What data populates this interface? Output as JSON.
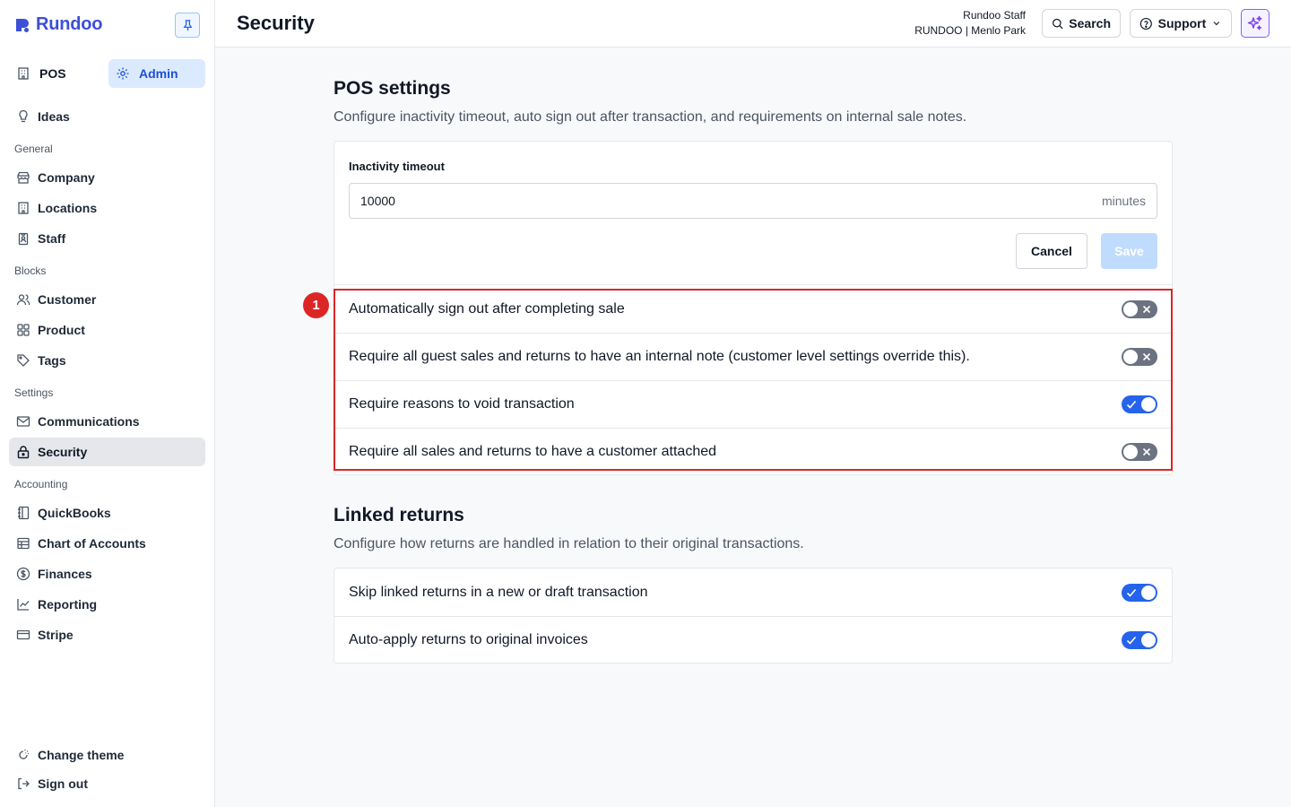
{
  "brand": {
    "name": "Rundoo"
  },
  "sidebar": {
    "modes": [
      {
        "label": "POS",
        "icon": "building-icon"
      },
      {
        "label": "Admin",
        "icon": "gear-icon",
        "active": true
      }
    ],
    "ideas": {
      "label": "Ideas",
      "icon": "lightbulb-icon"
    },
    "sections": {
      "general": "General",
      "blocks": "Blocks",
      "settings": "Settings",
      "accounting": "Accounting"
    },
    "items": {
      "company": "Company",
      "locations": "Locations",
      "staff": "Staff",
      "customer": "Customer",
      "product": "Product",
      "tags": "Tags",
      "communications": "Communications",
      "security": "Security",
      "quickbooks": "QuickBooks",
      "chart_of_accounts": "Chart of Accounts",
      "finances": "Finances",
      "reporting": "Reporting",
      "stripe": "Stripe"
    },
    "footer": {
      "change_theme": "Change theme",
      "sign_out": "Sign out"
    }
  },
  "header": {
    "title": "Security",
    "user_name": "Rundoo Staff",
    "user_location": "RUNDOO | Menlo Park",
    "search_label": "Search",
    "support_label": "Support"
  },
  "pos_settings": {
    "title": "POS settings",
    "description": "Configure inactivity timeout, auto sign out after transaction, and requirements on internal sale notes.",
    "inactivity": {
      "label": "Inactivity timeout",
      "value": "10000",
      "unit": "minutes"
    },
    "cancel_label": "Cancel",
    "save_label": "Save",
    "toggles": [
      {
        "label": "Automatically sign out after completing sale",
        "on": false
      },
      {
        "label": "Require all guest sales and returns to have an internal note (customer level settings override this).",
        "on": false
      },
      {
        "label": "Require reasons to void transaction",
        "on": true
      },
      {
        "label": "Require all sales and returns to have a customer attached",
        "on": false
      }
    ]
  },
  "linked_returns": {
    "title": "Linked returns",
    "description": "Configure how returns are handled in relation to their original transactions.",
    "toggles": [
      {
        "label": "Skip linked returns in a new or draft transaction",
        "on": true
      },
      {
        "label": "Auto-apply returns to original invoices",
        "on": true
      }
    ]
  },
  "annotation": {
    "badge": "1"
  },
  "colors": {
    "brand": "#3b4fd8",
    "toggle_on": "#2563eb",
    "toggle_off": "#6b7280",
    "highlight": "#dc2626"
  }
}
